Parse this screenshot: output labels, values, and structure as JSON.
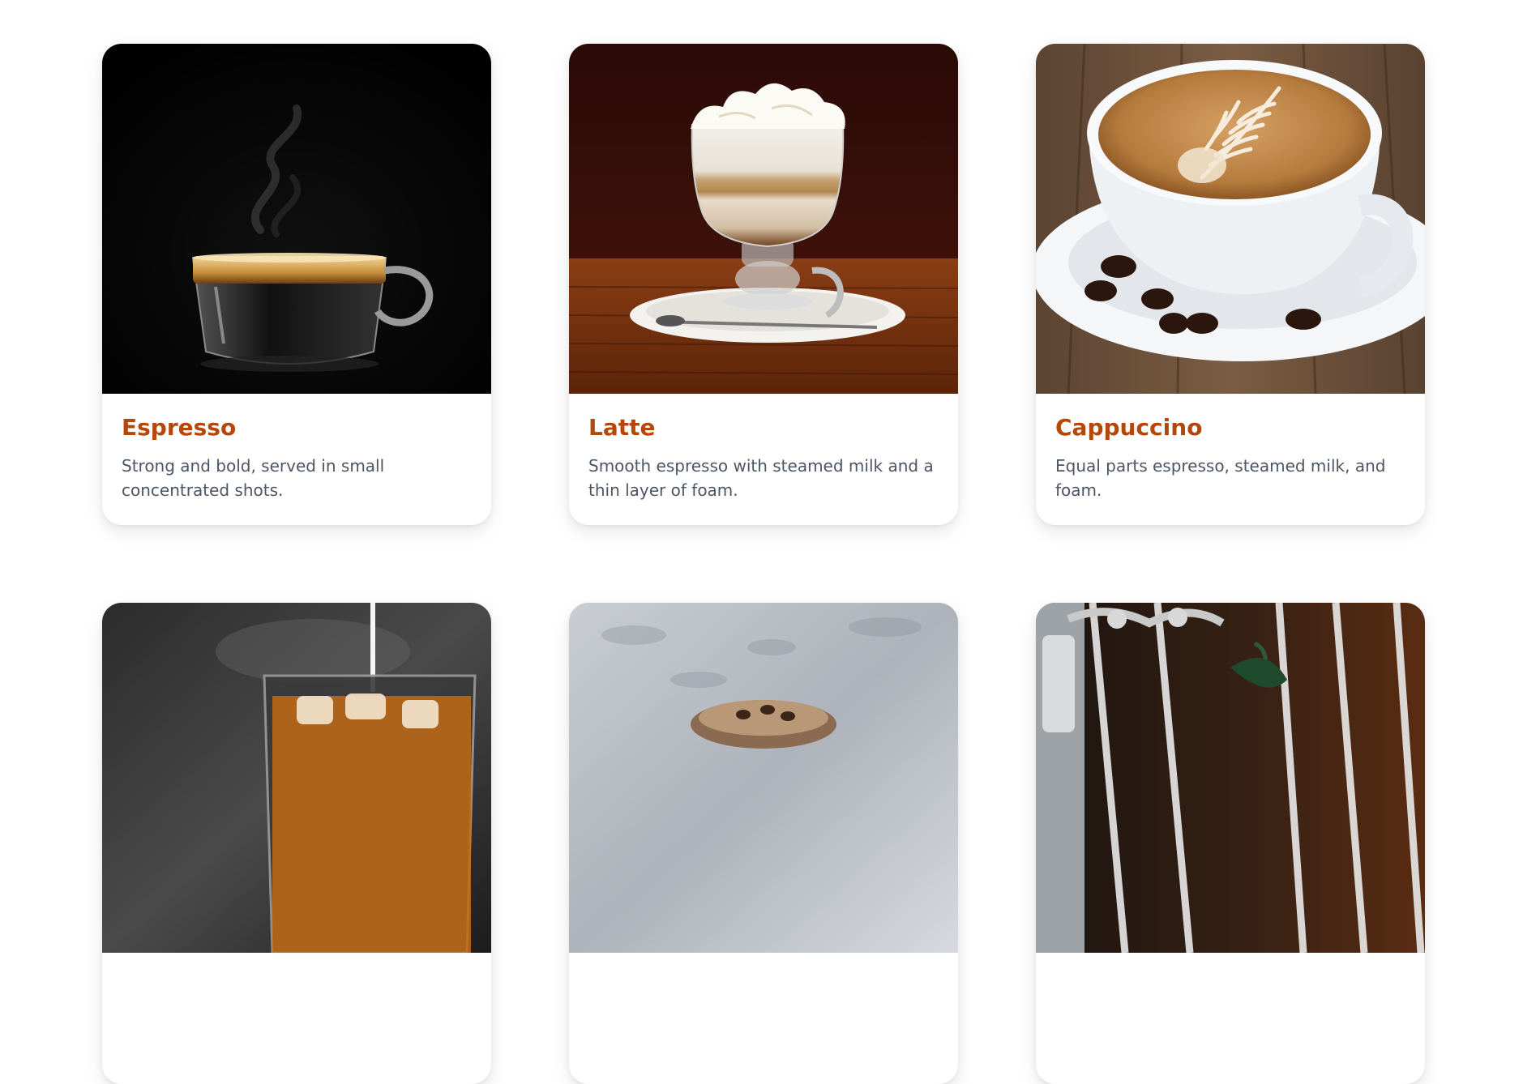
{
  "cards": [
    {
      "title": "Espresso",
      "description": "Strong and bold, served in small concentrated shots.",
      "image_icon": "espresso-photo"
    },
    {
      "title": "Latte",
      "description": "Smooth espresso with steamed milk and a thin layer of foam.",
      "image_icon": "latte-photo"
    },
    {
      "title": "Cappuccino",
      "description": "Equal parts espresso, steamed milk, and foam.",
      "image_icon": "cappuccino-photo"
    },
    {
      "title": "",
      "description": "",
      "image_icon": "iced-coffee-photo"
    },
    {
      "title": "",
      "description": "",
      "image_icon": "dessert-coffee-photo"
    },
    {
      "title": "",
      "description": "",
      "image_icon": "vintage-coffee-photo"
    }
  ],
  "colors": {
    "title": "#b54708",
    "text": "#4b5563",
    "background": "#ffffff"
  }
}
